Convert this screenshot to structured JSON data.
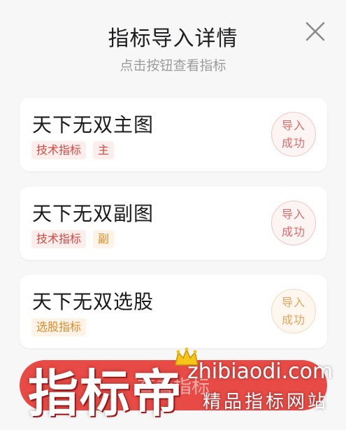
{
  "dialog": {
    "title": "指标导入详情",
    "subtitle": "点击按钮查看指标",
    "close_icon": "close-icon"
  },
  "cards": [
    {
      "name": "天下无双主图",
      "tags": [
        {
          "label": "技术指标",
          "color": "#d9473f"
        },
        {
          "label": "主",
          "color": "#d9473f"
        }
      ],
      "status_line1": "导入",
      "status_line2": "成功",
      "status_color": "#df6b6b"
    },
    {
      "name": "天下无双副图",
      "tags": [
        {
          "label": "技术指标",
          "color": "#d9473f"
        },
        {
          "label": "副",
          "color": "#e38a2a"
        }
      ],
      "status_line1": "导入",
      "status_line2": "成功",
      "status_color": "#df6b6b"
    },
    {
      "name": "天下无双选股",
      "tags": [
        {
          "label": "选股指标",
          "color": "#e38a2a"
        }
      ],
      "status_line1": "导入",
      "status_line2": "成功",
      "status_color": "#e6a35b"
    }
  ],
  "bottom_button": {
    "label": "查看指标",
    "color": "#e84a45"
  },
  "watermark": {
    "logo_text": "指标帝",
    "domain": "zhibiaodi.com",
    "slogan": "精品指标网站",
    "icon": "crown-icon"
  }
}
